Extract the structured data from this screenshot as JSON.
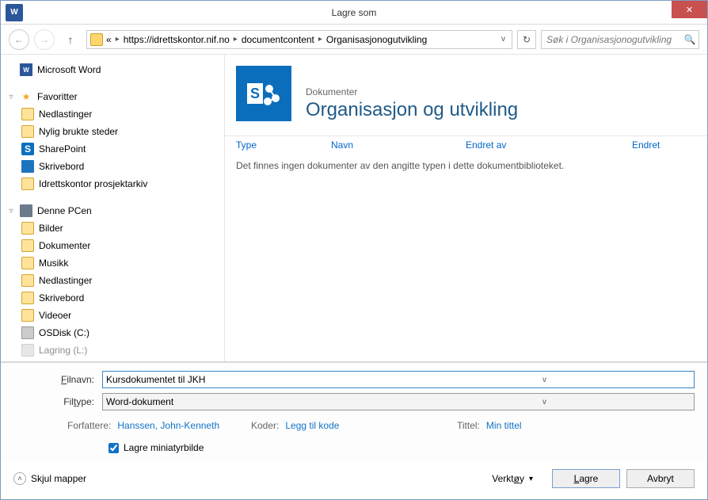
{
  "window": {
    "title": "Lagre som"
  },
  "nav": {
    "breadcrumb_prefix": "«",
    "crumb1": "https://idrettskontor.nif.no",
    "crumb2": "documentcontent",
    "crumb3": "Organisasjonogutvikling",
    "search_placeholder": "Søk i Organisasjonogutvikling"
  },
  "tree": {
    "root": "Microsoft Word",
    "favorites": "Favoritter",
    "fav_items": [
      "Nedlastinger",
      "Nylig brukte steder",
      "SharePoint",
      "Skrivebord",
      "Idrettskontor prosjektarkiv"
    ],
    "this_pc": "Denne PCen",
    "pc_items": [
      "Bilder",
      "Dokumenter",
      "Musikk",
      "Nedlastinger",
      "Skrivebord",
      "Videoer",
      "OSDisk (C:)",
      "Lagring (L:)"
    ]
  },
  "doclib": {
    "category": "Dokumenter",
    "title": "Organisasjon og utvikling",
    "columns": {
      "type": "Type",
      "name": "Navn",
      "modified_by": "Endret av",
      "modified": "Endret"
    },
    "empty": "Det finnes ingen dokumenter av den angitte typen i dette dokumentbiblioteket."
  },
  "form": {
    "filename_label": "Filnavn:",
    "filename_value": "Kursdokumentet til JKH",
    "filetype_label": "Filtype:",
    "filetype_value": "Word-dokument",
    "authors_label": "Forfattere:",
    "authors_value": "Hanssen, John-Kenneth",
    "codes_label": "Koder:",
    "codes_value": "Legg til kode",
    "title_label": "Tittel:",
    "title_value": "Min tittel",
    "thumb_label": "Lagre miniatyrbilde"
  },
  "bottom": {
    "hide_folders": "Skjul mapper",
    "tools": "Verktøy",
    "save": "Lagre",
    "cancel": "Avbryt"
  }
}
